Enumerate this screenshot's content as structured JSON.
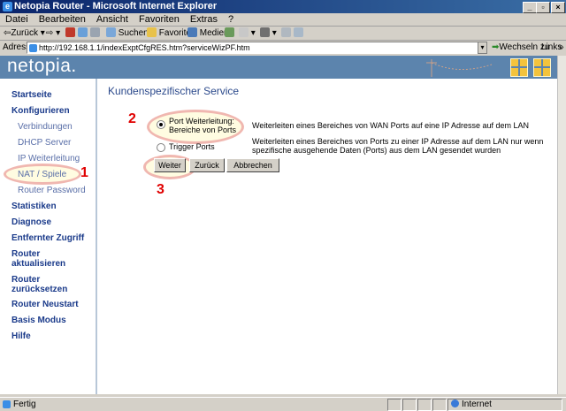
{
  "window": {
    "title": "Netopia Router - Microsoft Internet Explorer",
    "controls": [
      "_",
      "▫",
      "×"
    ]
  },
  "menu": [
    "Datei",
    "Bearbeiten",
    "Ansicht",
    "Favoriten",
    "Extras",
    "?"
  ],
  "toolbar": {
    "back": "Zurück",
    "search": "Suchen",
    "favorites": "Favoriten",
    "media": "Medien"
  },
  "address": {
    "label": "Adresse",
    "url": "http://192.168.1.1/indexExptCfgRES.htm?serviceWizPF.htm",
    "go": "Wechseln zu",
    "links": "Links"
  },
  "header": {
    "logo": "netopia."
  },
  "sidebar": {
    "items": [
      {
        "label": "Startseite",
        "type": "main"
      },
      {
        "label": "Konfigurieren",
        "type": "main"
      },
      {
        "label": "Verbindungen",
        "type": "sub"
      },
      {
        "label": "DHCP Server",
        "type": "sub"
      },
      {
        "label": "IP Weiterleitung",
        "type": "sub"
      },
      {
        "label": "NAT / Spiele",
        "type": "sub"
      },
      {
        "label": "Router Password",
        "type": "sub"
      },
      {
        "label": "Statistiken",
        "type": "main"
      },
      {
        "label": "Diagnose",
        "type": "main"
      },
      {
        "label": "Entfernter Zugriff",
        "type": "main"
      },
      {
        "label": "Router aktualisieren",
        "type": "main"
      },
      {
        "label": "Router zurücksetzen",
        "type": "main"
      },
      {
        "label": "Router Neustart",
        "type": "main"
      },
      {
        "label": "Basis Modus",
        "type": "main"
      },
      {
        "label": "Hilfe",
        "type": "main"
      }
    ]
  },
  "main": {
    "heading": "Kundenspezifischer Service",
    "options": [
      {
        "label_line1": "Port Weiterleitung:",
        "label_line2": "Bereiche von Ports",
        "description": "Weiterleiten eines Bereiches von WAN Ports auf eine IP Adresse auf dem LAN",
        "selected": true
      },
      {
        "label_line1": "Trigger Ports",
        "label_line2": "",
        "description_line1": "Weiterleiten eines Bereiches von Ports zu einer IP Adresse auf dem LAN nur wenn",
        "description_line2": "spezifische ausgehende Daten (Ports) aus dem LAN gesendet wurden",
        "selected": false
      }
    ],
    "buttons": {
      "next": "Weiter",
      "back": "Zurück",
      "cancel": "Abbrechen"
    }
  },
  "annotations": {
    "mark1": "1",
    "mark2": "2",
    "mark3": "3"
  },
  "status": {
    "left": "Fertig",
    "zone": "Internet"
  }
}
